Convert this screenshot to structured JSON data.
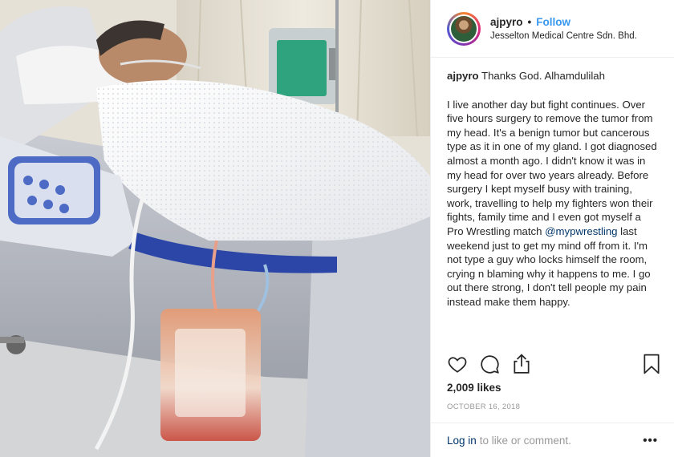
{
  "post": {
    "username": "ajpyro",
    "separator": "•",
    "follow_label": "Follow",
    "location": "Jesselton Medical Centre Sdn. Bhd.",
    "caption": {
      "username": "ajpyro",
      "first_line": "Thanks God. Alhamdulilah",
      "body_before_mention": "I live another day but fight continues. Over five hours surgery to remove the tumor from my head. It's a benign tumor but cancerous type as it in one of my gland. I got diagnosed almost a month ago. I didn't know it was in my head for over two years already. Before surgery I kept myself busy with training, work, travelling to help my fighters won their fights, family time and I even got myself a Pro Wrestling match",
      "mention": "@mypwrestling",
      "body_after_mention": "last weekend just to get my mind off from it. I'm not type a guy who locks himself the room, crying n blaming why it happens to me. I go out there strong, I don't tell people my pain instead make them happy."
    },
    "likes": "2,009 likes",
    "date": "October 16, 2018",
    "comment_login_label": "Log in",
    "comment_prompt": "to like or comment.",
    "more_label": "•••"
  },
  "icons": {
    "like": "heart-icon",
    "comment": "comment-icon",
    "share": "share-icon",
    "save": "bookmark-icon"
  },
  "colors": {
    "link": "#3897f0",
    "mention": "#003569",
    "meta_gray": "#999999",
    "text": "#262626"
  }
}
